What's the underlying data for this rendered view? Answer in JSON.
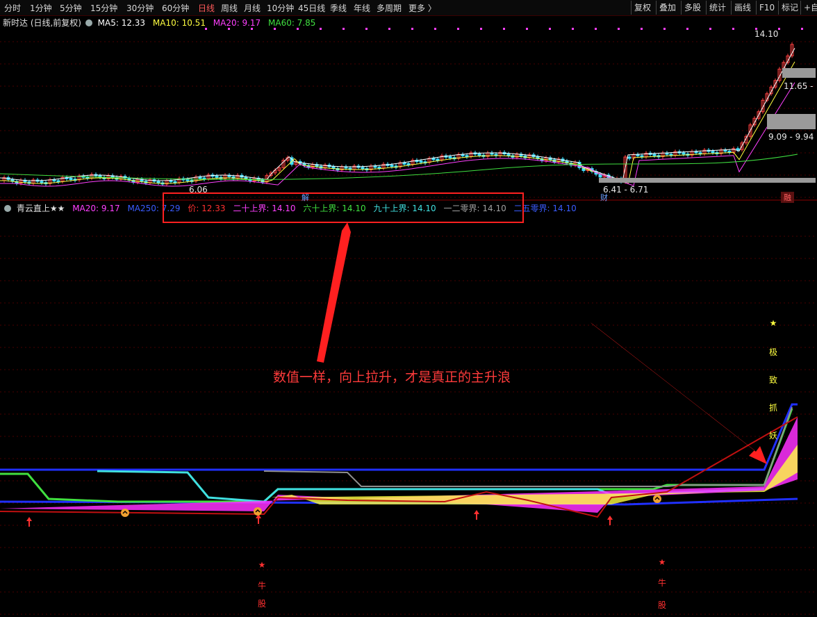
{
  "toolbar": {
    "periods": [
      "分时",
      "1分钟",
      "5分钟",
      "15分钟",
      "30分钟",
      "60分钟",
      "日线",
      "周线",
      "月线",
      "10分钟",
      "45日线",
      "季线",
      "年线",
      "多周期",
      "更多 〉"
    ],
    "active_period": "日线",
    "right_buttons": [
      "复权",
      "叠加",
      "多股",
      "统计",
      "画线",
      "F10",
      "标记",
      "+自"
    ]
  },
  "main_chart": {
    "stock_title": "新时达 (日线,前复权)",
    "ma_labels": [
      {
        "text": "MA5: 12.33",
        "color": "#ffffff"
      },
      {
        "text": "MA10: 10.51",
        "color": "#ffff40"
      },
      {
        "text": "MA20: 9.17",
        "color": "#ff40ff"
      },
      {
        "text": "MA60: 7.85",
        "color": "#40e040"
      }
    ],
    "price_high": "14.10",
    "price_low_left": "6.06",
    "ranges": [
      "11.65 -",
      "9.09 - 9.94",
      "6.41 - 6.71"
    ],
    "tag_jie": "解",
    "tag_cai": "财",
    "tag_rongquan": "融"
  },
  "indicator": {
    "name": "青云直上★★",
    "labels": [
      {
        "text": "MA20: 9.17",
        "color": "#ff40ff"
      },
      {
        "text": "MA250: 7.29",
        "color": "#3a5cff"
      },
      {
        "text": "价: 12.33",
        "color": "#ff3030"
      },
      {
        "text": "二十上界: 14.10",
        "color": "#ff40ff"
      },
      {
        "text": "六十上界: 14.10",
        "color": "#40e040"
      },
      {
        "text": "九十上界: 14.10",
        "color": "#40e0e0"
      },
      {
        "text": "一二零界: 14.10",
        "color": "#a0a0a0"
      },
      {
        "text": "二五零界: 14.10",
        "color": "#3a5cff"
      }
    ],
    "vertical_text_right": [
      "★",
      "极",
      "致",
      "抓",
      "妖"
    ],
    "vertical_text_bull": [
      "★",
      "牛",
      "股"
    ]
  },
  "annotation": "数值一样，向上拉升，才是真正的主升浪",
  "colors": {
    "accent_red": "#ff3b3b",
    "background": "#000000",
    "grid": "#5a0000"
  }
}
